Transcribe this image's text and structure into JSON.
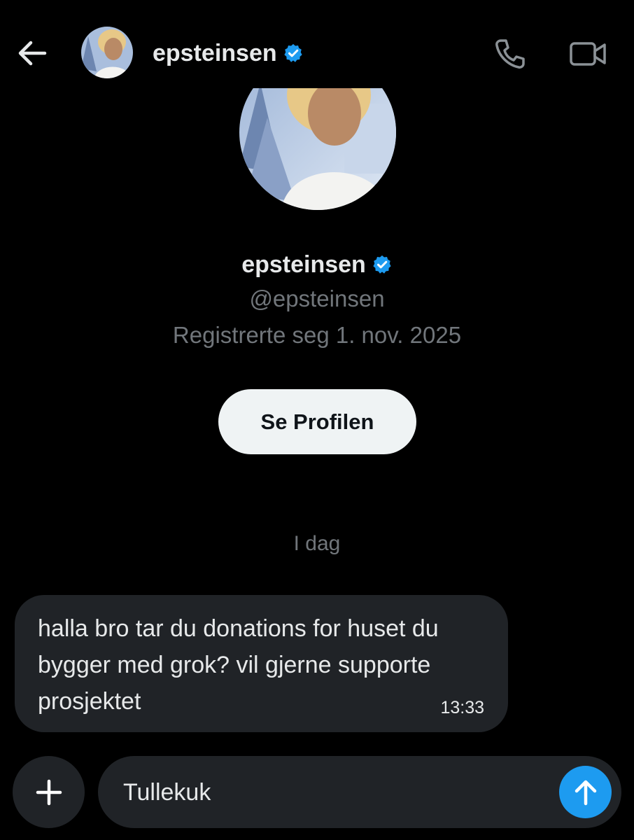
{
  "header": {
    "display_name": "epsteinsen",
    "back_icon": "arrow-left-icon",
    "verified_icon": "verified-badge-icon",
    "call_icon": "phone-icon",
    "video_icon": "video-camera-icon"
  },
  "profile": {
    "display_name": "epsteinsen",
    "handle": "@epsteinsen",
    "joined": "Registrerte seg 1. nov. 2025",
    "view_profile_label": "Se Profilen"
  },
  "conversation": {
    "date_separator": "I dag",
    "messages": [
      {
        "text": "halla bro tar du donations for huset du bygger med grok? vil gjerne supporte prosjektet",
        "time": "13:33",
        "direction": "incoming"
      }
    ]
  },
  "composer": {
    "value": "Tullekuk",
    "plus_icon": "plus-icon",
    "send_icon": "send-arrow-up-icon"
  },
  "colors": {
    "background": "#000000",
    "text_primary": "#e7e9ea",
    "text_secondary": "#71767b",
    "bubble": "#202327",
    "accent": "#1d9bf0",
    "button_light": "#eff3f4"
  }
}
